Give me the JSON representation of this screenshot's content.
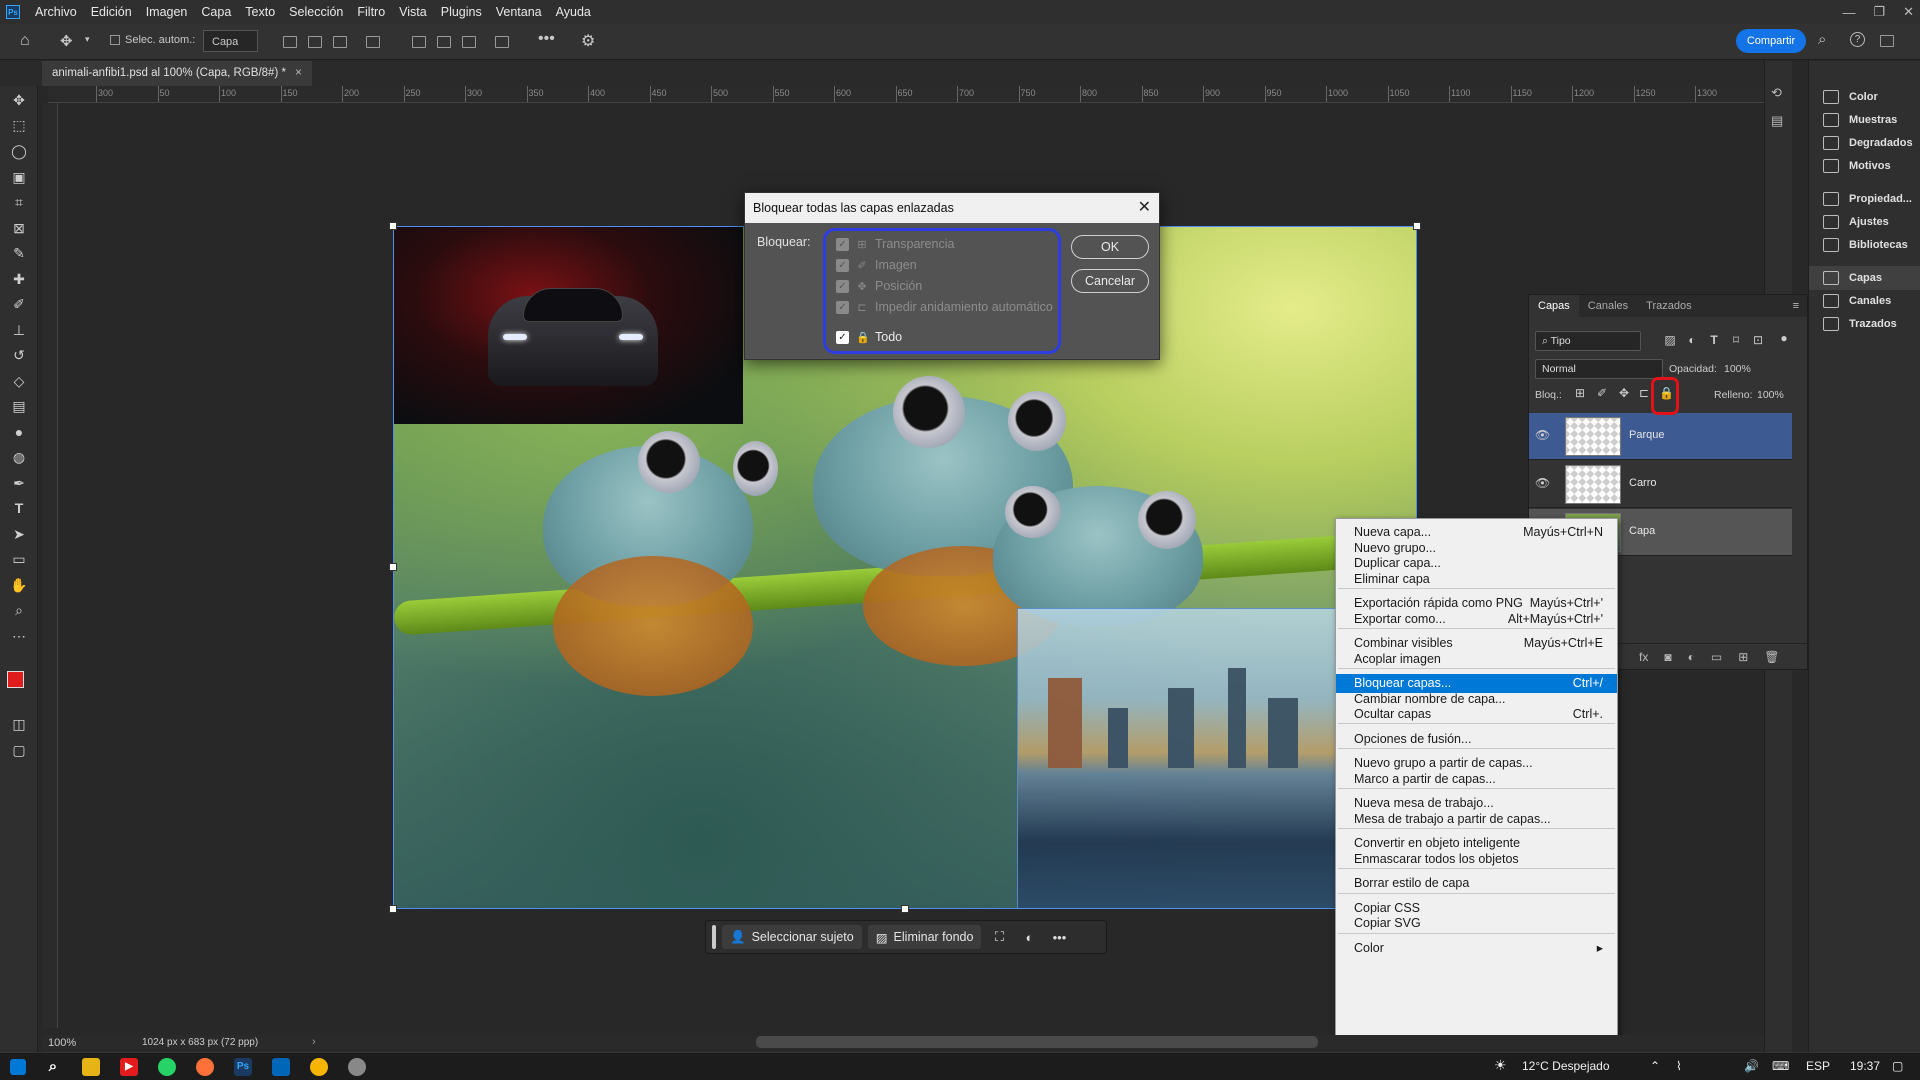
{
  "menubar": {
    "app_icon": "Ps",
    "items": [
      "Archivo",
      "Edición",
      "Imagen",
      "Capa",
      "Texto",
      "Selección",
      "Filtro",
      "Vista",
      "Plugins",
      "Ventana",
      "Ayuda"
    ]
  },
  "options": {
    "auto_select": "Selec. autom.:",
    "target": "Capa",
    "share": "Compartir"
  },
  "document": {
    "tab": "animali-anfibi1.psd al 100% (Capa, RGB/8#) *"
  },
  "ruler_marks": [
    "300",
    "50",
    "100",
    "150",
    "200",
    "250",
    "300",
    "350",
    "400",
    "450",
    "500",
    "550",
    "600",
    "650",
    "700",
    "750",
    "800",
    "850",
    "900",
    "950",
    "1000",
    "1050",
    "1100",
    "1150",
    "1200",
    "1250",
    "1300"
  ],
  "dialog": {
    "title": "Bloquear todas las capas enlazadas",
    "lock_label": "Bloquear:",
    "options": [
      {
        "label": "Transparencia",
        "checked": true,
        "enabled": false,
        "icon": "checker-icon"
      },
      {
        "label": "Imagen",
        "checked": true,
        "enabled": false,
        "icon": "brush-icon"
      },
      {
        "label": "Posición",
        "checked": true,
        "enabled": false,
        "icon": "move-icon"
      },
      {
        "label": "Impedir anidamiento automático",
        "checked": true,
        "enabled": false,
        "icon": "artboard-icon"
      },
      {
        "label": "Todo",
        "checked": true,
        "enabled": true,
        "icon": "lock-icon"
      }
    ],
    "ok": "OK",
    "cancel": "Cancelar"
  },
  "contextual_taskbar": {
    "select_subject": "Seleccionar sujeto",
    "remove_bg": "Eliminar fondo"
  },
  "dock": [
    {
      "label": "Color",
      "icon": "color-icon"
    },
    {
      "label": "Muestras",
      "icon": "swatches-icon"
    },
    {
      "label": "Degradados",
      "icon": "gradient-icon"
    },
    {
      "label": "Motivos",
      "icon": "pattern-icon"
    },
    {
      "label": "Propiedad...",
      "icon": "properties-icon"
    },
    {
      "label": "Ajustes",
      "icon": "adjustments-icon"
    },
    {
      "label": "Bibliotecas",
      "icon": "libraries-icon"
    },
    {
      "label": "Capas",
      "icon": "layers-icon"
    },
    {
      "label": "Canales",
      "icon": "channels-icon"
    },
    {
      "label": "Trazados",
      "icon": "paths-icon"
    }
  ],
  "layers_panel": {
    "tabs": [
      "Capas",
      "Canales",
      "Trazados"
    ],
    "filter": "Tipo",
    "blend": "Normal",
    "opacity_label": "Opacidad:",
    "opacity": "100%",
    "lock_label": "Bloq.:",
    "fill_label": "Relleno:",
    "fill": "100%",
    "layers": [
      {
        "name": "Parque",
        "selected": true
      },
      {
        "name": "Carro",
        "selected": false
      },
      {
        "name": "Capa",
        "selected": false
      }
    ]
  },
  "context_menu": {
    "items": [
      {
        "label": "Nueva capa...",
        "shortcut": "Mayús+Ctrl+N"
      },
      {
        "label": "Nuevo grupo...",
        "shortcut": ""
      },
      {
        "label": "Duplicar capa...",
        "shortcut": ""
      },
      {
        "label": "Eliminar capa",
        "shortcut": ""
      },
      {
        "label": "Exportación rápida como PNG",
        "shortcut": "Mayús+Ctrl+'"
      },
      {
        "label": "Exportar como...",
        "shortcut": "Alt+Mayús+Ctrl+'"
      },
      {
        "label": "Combinar visibles",
        "shortcut": "Mayús+Ctrl+E"
      },
      {
        "label": "Acoplar imagen",
        "shortcut": ""
      },
      {
        "label": "Bloquear capas...",
        "shortcut": "Ctrl+/"
      },
      {
        "label": "Cambiar nombre de capa...",
        "shortcut": ""
      },
      {
        "label": "Ocultar capas",
        "shortcut": "Ctrl+."
      },
      {
        "label": "Opciones de fusión...",
        "shortcut": ""
      },
      {
        "label": "Nuevo grupo a partir de capas...",
        "shortcut": ""
      },
      {
        "label": "Marco a partir de capas...",
        "shortcut": ""
      },
      {
        "label": "Nueva mesa de trabajo...",
        "shortcut": ""
      },
      {
        "label": "Mesa de trabajo a partir de capas...",
        "shortcut": ""
      },
      {
        "label": "Convertir en objeto inteligente",
        "shortcut": ""
      },
      {
        "label": "Enmascarar todos los objetos",
        "shortcut": ""
      },
      {
        "label": "Borrar estilo de capa",
        "shortcut": ""
      },
      {
        "label": "Copiar CSS",
        "shortcut": ""
      },
      {
        "label": "Copiar SVG",
        "shortcut": ""
      },
      {
        "label": "Color",
        "shortcut": "▸"
      }
    ]
  },
  "status": {
    "zoom": "100%",
    "doc_size": "1024 px x 683 px (72 ppp)"
  },
  "taskbar": {
    "weather": "12°C Despejado",
    "lang": "ESP",
    "time": "19:37"
  },
  "colors": {
    "accent": "#1473e6",
    "highlight": "#0078d7",
    "lock_ring": "#e0121a",
    "dialog_group": "#2c3ee0"
  }
}
